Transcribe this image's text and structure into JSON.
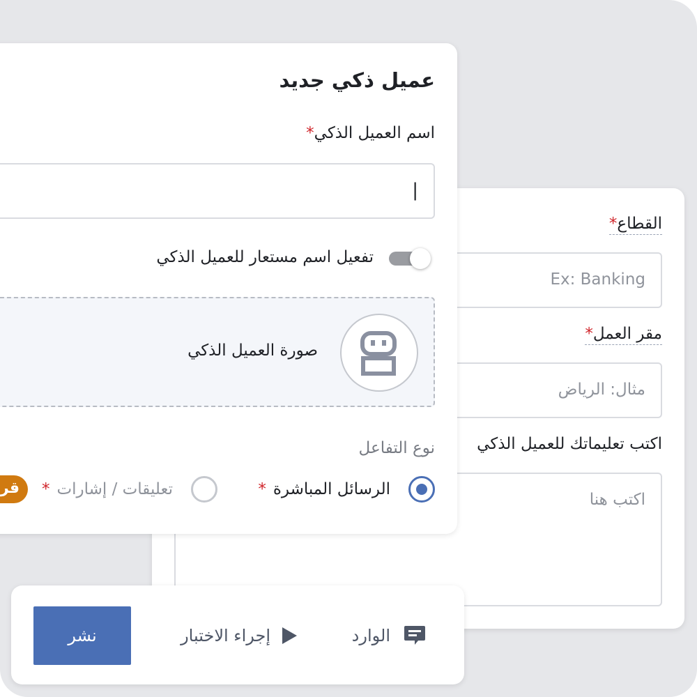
{
  "back_card": {
    "sector": {
      "label": "القطاع",
      "required_mark": "*",
      "placeholder": "Ex: Banking"
    },
    "location": {
      "label": "مقر العمل",
      "required_mark": "*",
      "placeholder": "مثال: الرياض"
    },
    "instructions": {
      "label": "اكتب تعليماتك للعميل الذكي",
      "placeholder": "اكتب هنا"
    }
  },
  "front_card": {
    "title": "عميل ذكي جديد",
    "name_field": {
      "label": "اسم العميل الذكي",
      "required_mark": "*",
      "value": "",
      "cursor": "|"
    },
    "alias_toggle": {
      "label": "تفعيل اسم مستعار للعميل الذكي",
      "enabled": false
    },
    "avatar_upload": {
      "label": "صورة العميل الذكي",
      "icon": "robot-icon"
    },
    "interaction_type": {
      "label": "نوع التفاعل",
      "options": [
        {
          "label": "الرسائل المباشرة",
          "required_mark": "*",
          "selected": true
        },
        {
          "label": "تعليقات / إشارات",
          "required_mark": "*",
          "selected": false
        }
      ],
      "badge": "قر"
    }
  },
  "bottom_bar": {
    "inbox_label": "الوارد",
    "inbox_icon": "chat-icon",
    "test_label": "إجراء الاختبار",
    "test_icon": "play-icon",
    "publish_label": "نشر"
  },
  "colors": {
    "primary": "#4a6fb5",
    "required": "#d0252b",
    "badge": "#d07a10",
    "background": "#e6e7ea"
  }
}
